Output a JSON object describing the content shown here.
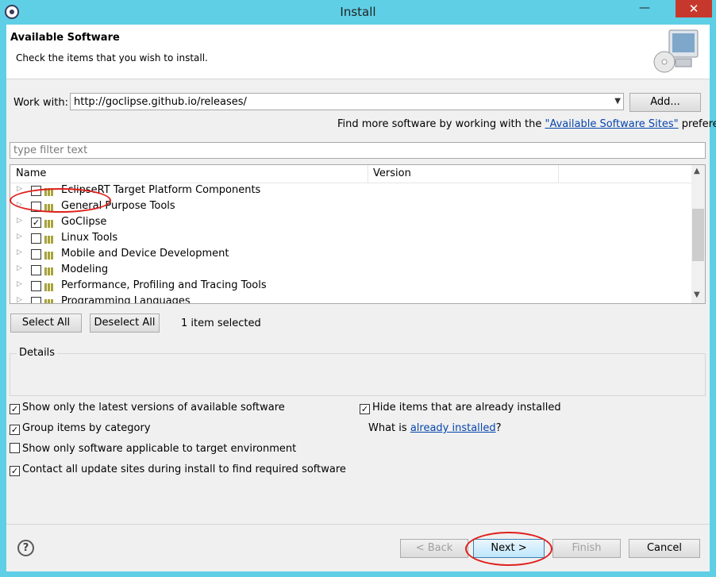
{
  "window": {
    "title": "Install",
    "minimize_glyph": "—",
    "close_glyph": "✕"
  },
  "header": {
    "title": "Available Software",
    "subtitle": "Check the items that you wish to install."
  },
  "work_with": {
    "label": "Work with:",
    "value": "http://goclipse.github.io/releases/",
    "add_label": "Add...",
    "find_more_prefix": "Find more software by working with the ",
    "find_more_link": "\"Available Software Sites\"",
    "find_more_suffix": " preferences."
  },
  "filter": {
    "placeholder": "type filter text"
  },
  "tree": {
    "columns": [
      "Name",
      "Version"
    ],
    "items": [
      {
        "label": "EclipseRT Target Platform Components",
        "checked": false
      },
      {
        "label": "General Purpose Tools",
        "checked": false
      },
      {
        "label": "GoClipse",
        "checked": true
      },
      {
        "label": "Linux Tools",
        "checked": false
      },
      {
        "label": "Mobile and Device Development",
        "checked": false
      },
      {
        "label": "Modeling",
        "checked": false
      },
      {
        "label": "Performance, Profiling and Tracing Tools",
        "checked": false
      },
      {
        "label": "Programming Languages",
        "checked": false
      }
    ]
  },
  "selection": {
    "select_all": "Select All",
    "deselect_all": "Deselect All",
    "status": "1 item selected"
  },
  "details": {
    "label": "Details"
  },
  "options": {
    "latest_versions": {
      "label": "Show only the latest versions of available software",
      "checked": true
    },
    "group_by_category": {
      "label": "Group items by category",
      "checked": true
    },
    "applicable_only": {
      "label": "Show only software applicable to target environment",
      "checked": false
    },
    "contact_sites": {
      "label": "Contact all update sites during install to find required software",
      "checked": true
    },
    "hide_installed": {
      "label": "Hide items that are already installed",
      "checked": true
    },
    "what_is_prefix": "What is ",
    "what_is_link": "already installed",
    "what_is_suffix": "?"
  },
  "footer": {
    "help_glyph": "?",
    "back": "< Back",
    "next": "Next >",
    "finish": "Finish",
    "cancel": "Cancel"
  },
  "colors": {
    "titlebar": "#5fcfe6",
    "close": "#c7382c",
    "annotation": "#e0201b",
    "link": "#0645ad"
  }
}
